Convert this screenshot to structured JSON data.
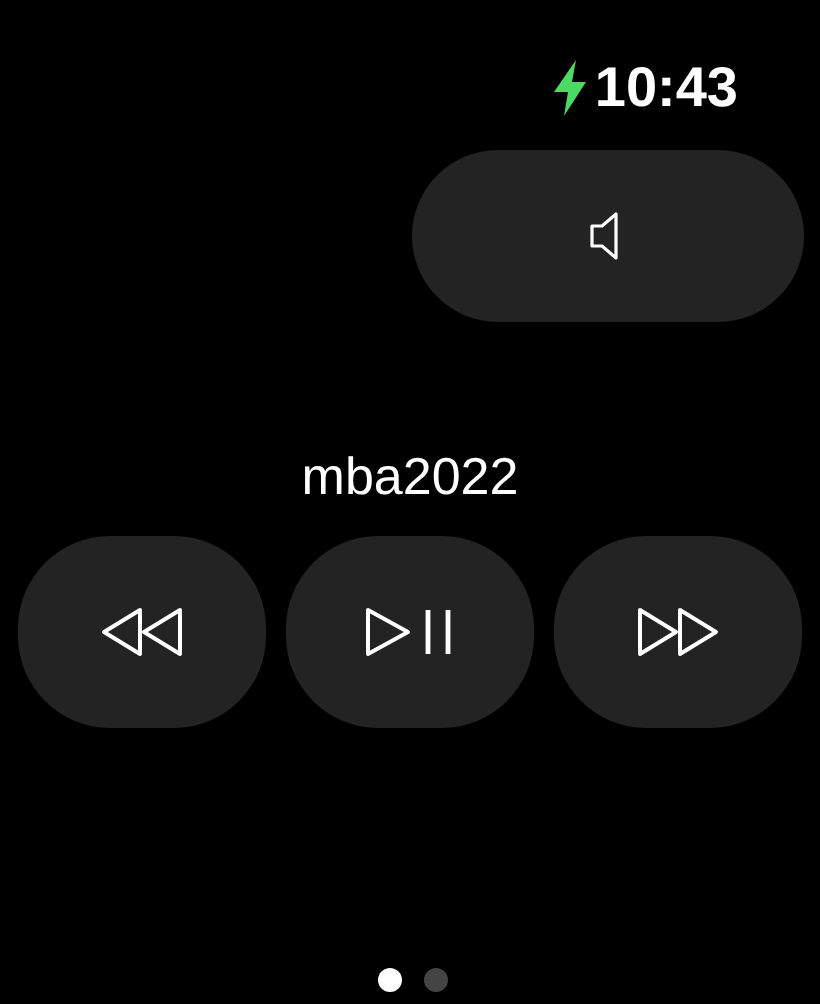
{
  "status_bar": {
    "charging": true,
    "time": "10:43"
  },
  "volume_button": {
    "kind": "speaker"
  },
  "now_playing": {
    "title": "mba2022"
  },
  "controls": [
    {
      "kind": "rewind"
    },
    {
      "kind": "play_pause"
    },
    {
      "kind": "forward"
    }
  ],
  "page_dots": [
    {
      "selected": true
    },
    {
      "selected": false
    }
  ]
}
